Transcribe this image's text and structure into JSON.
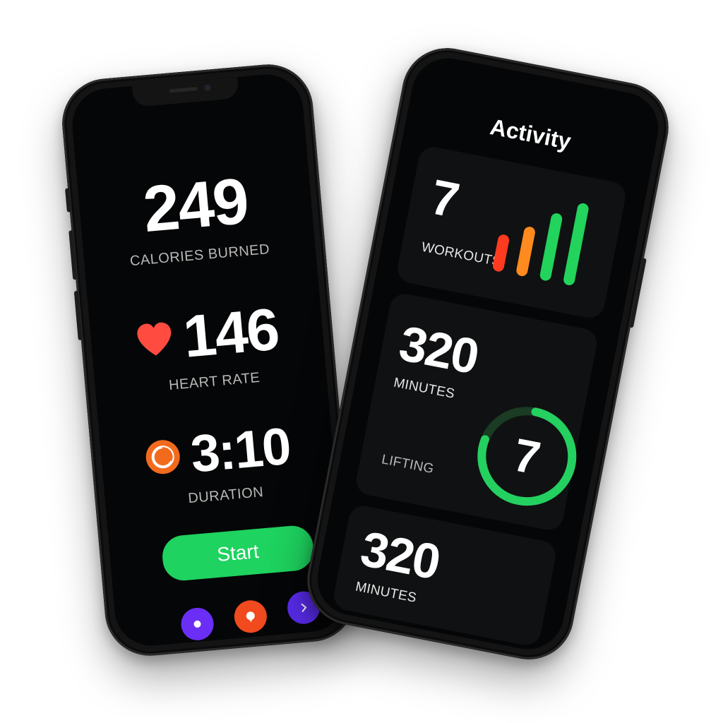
{
  "left_phone": {
    "calories": {
      "value": "249",
      "label": "CALORIES BURNED"
    },
    "heart_rate": {
      "value": "146",
      "label": "HEART RATE",
      "icon": "heart-icon",
      "color": "#ff4b40"
    },
    "duration": {
      "value": "3:10",
      "label": "DURATION",
      "icon": "timer-icon",
      "color": "#f26b1d"
    },
    "start_label": "Start",
    "start_color": "#1ed35f",
    "bottom_buttons": [
      {
        "icon": "record-icon",
        "color": "#6a2ef5"
      },
      {
        "icon": "chat-bubble-icon",
        "color": "#f04a1e"
      },
      {
        "icon": "chevron-right-icon",
        "color": "#5b2cf0"
      }
    ]
  },
  "right_phone": {
    "title": "Activity",
    "workouts": {
      "value": "7",
      "label": "WORKOUTS",
      "bars": [
        {
          "level": 0.45,
          "color": "#ff3b1f"
        },
        {
          "level": 0.6,
          "color": "#ff8a1f"
        },
        {
          "level": 0.82,
          "color": "#22d35c"
        },
        {
          "level": 1.0,
          "color": "#22d35c"
        }
      ]
    },
    "minutes_card": {
      "value": "320",
      "label": "MINUTES",
      "sub_label": "LIFTING",
      "ring_value": "7",
      "ring_progress": 0.78,
      "ring_color": "#24d060"
    },
    "minutes_card_2": {
      "value": "320",
      "label": "MINUTES"
    }
  }
}
